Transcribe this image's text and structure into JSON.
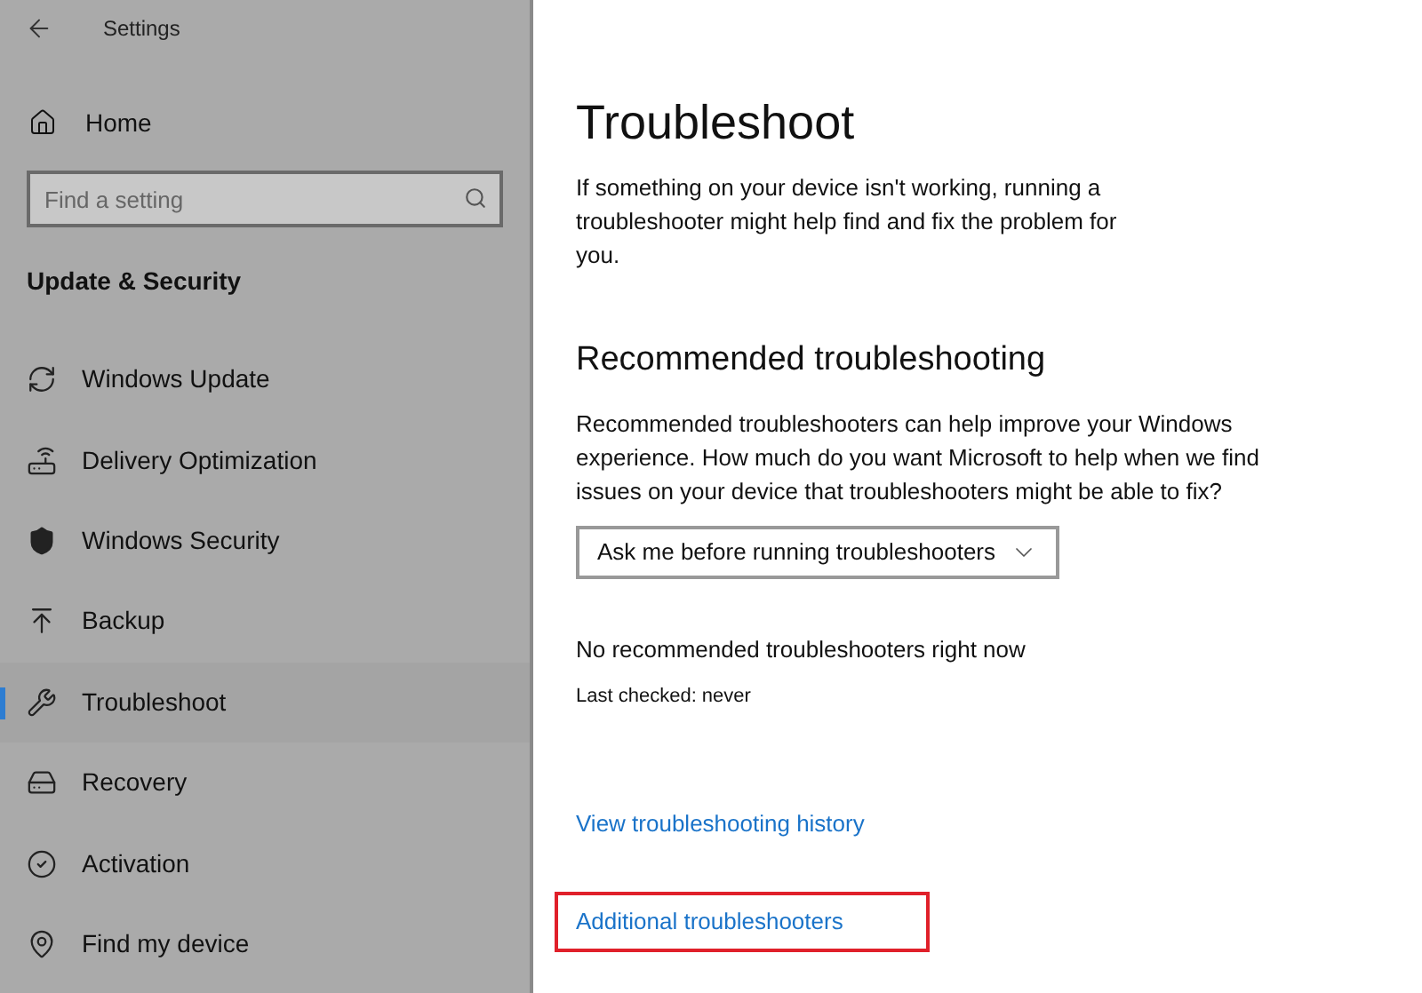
{
  "window": {
    "title": "Settings"
  },
  "sidebar": {
    "home": "Home",
    "search": {
      "placeholder": "Find a setting"
    },
    "section": "Update & Security",
    "items": [
      {
        "kind": "update",
        "label": "Windows Update",
        "selected": false
      },
      {
        "kind": "delivery",
        "label": "Delivery Optimization",
        "selected": false
      },
      {
        "kind": "security",
        "label": "Windows Security",
        "selected": false
      },
      {
        "kind": "backup",
        "label": "Backup",
        "selected": false
      },
      {
        "kind": "troubleshoot",
        "label": "Troubleshoot",
        "selected": true
      },
      {
        "kind": "recovery",
        "label": "Recovery",
        "selected": false
      },
      {
        "kind": "activation",
        "label": "Activation",
        "selected": false
      },
      {
        "kind": "find",
        "label": "Find my device",
        "selected": false
      }
    ]
  },
  "main": {
    "title": "Troubleshoot",
    "intro": "If something on your device isn't working, running a troubleshooter might help find and fix the problem for you.",
    "heading": "Recommended troubleshooting",
    "description": "Recommended troubleshooters can help improve your Windows experience. How much do you want Microsoft to help when we find issues on your device that troubleshooters might be able to fix?",
    "dropdown": {
      "value": "Ask me before running troubleshooters"
    },
    "status": "No recommended troubleshooters right now",
    "last_checked": "Last checked: never",
    "links": [
      {
        "label": "View troubleshooting history",
        "highlighted": false
      },
      {
        "label": "Additional troubleshooters",
        "highlighted": true
      }
    ]
  }
}
